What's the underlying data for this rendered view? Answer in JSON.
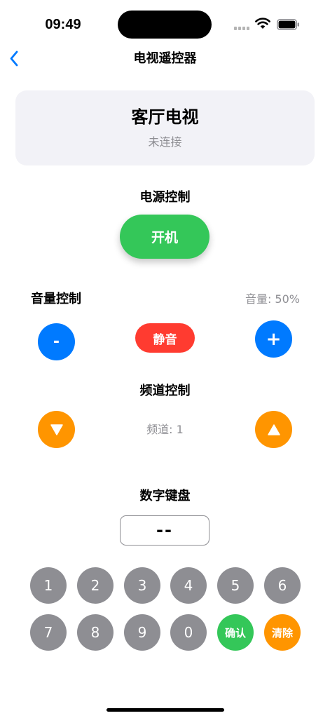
{
  "status_bar": {
    "time": "09:49"
  },
  "nav": {
    "title": "电视遥控器",
    "back_icon": "chevron-left-icon"
  },
  "device": {
    "name": "客厅电视",
    "status": "未连接"
  },
  "power": {
    "section_title": "电源控制",
    "button_label": "开机"
  },
  "volume": {
    "section_title": "音量控制",
    "readout": "音量: 50%",
    "down_label": "-",
    "up_label": "+",
    "mute_label": "静音"
  },
  "channel": {
    "section_title": "频道控制",
    "readout": "频道: 1",
    "down_icon": "triangle-down-icon",
    "up_icon": "triangle-up-icon"
  },
  "keypad": {
    "section_title": "数字键盘",
    "display": "--",
    "keys": [
      "1",
      "2",
      "3",
      "4",
      "5",
      "6",
      "7",
      "8",
      "9",
      "0"
    ],
    "confirm_label": "确认",
    "clear_label": "清除"
  },
  "colors": {
    "accent_blue": "#007aff",
    "power_green": "#34c759",
    "mute_red": "#ff3b30",
    "channel_orange": "#ff9500",
    "key_gray": "#8e8e93",
    "card_background": "#f2f2f7"
  }
}
